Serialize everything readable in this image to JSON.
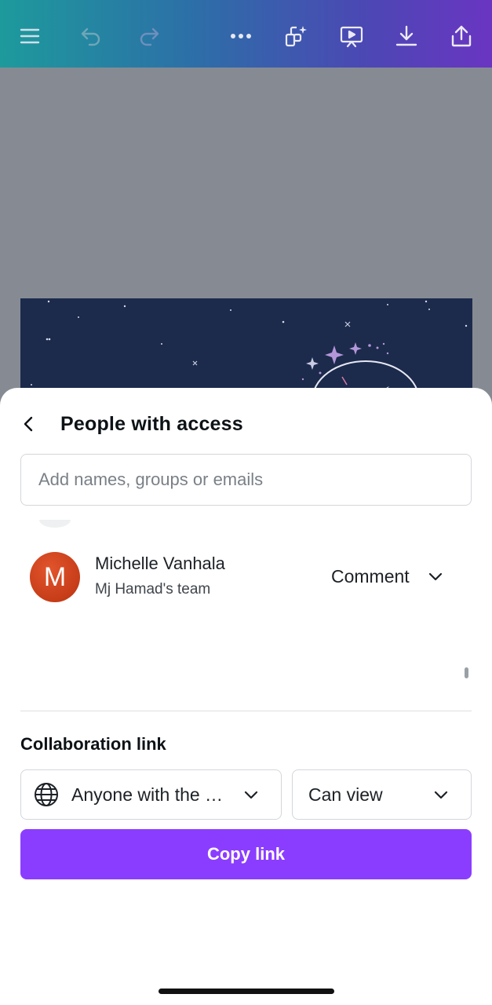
{
  "toolbar": {
    "icons": [
      "menu-icon",
      "undo-icon",
      "redo-icon",
      "more-icon",
      "magic-resize-icon",
      "present-icon",
      "download-icon",
      "share-icon"
    ]
  },
  "sheet": {
    "title": "People with access",
    "search_placeholder": "Add names, groups or emails",
    "members": [
      {
        "initial": "M",
        "name": "Michelle Vanhala",
        "team": "Mj Hamad's team",
        "role": "Comment"
      }
    ],
    "collaboration": {
      "title": "Collaboration link",
      "access": "Anyone with the …",
      "permission": "Can view",
      "copy_label": "Copy link"
    }
  },
  "colors": {
    "brand_purple": "#8b3dff",
    "avatar_orange": "#c63d18",
    "toolbar_gradient_start": "#1d9a9c",
    "toolbar_gradient_end": "#6a35c2"
  }
}
